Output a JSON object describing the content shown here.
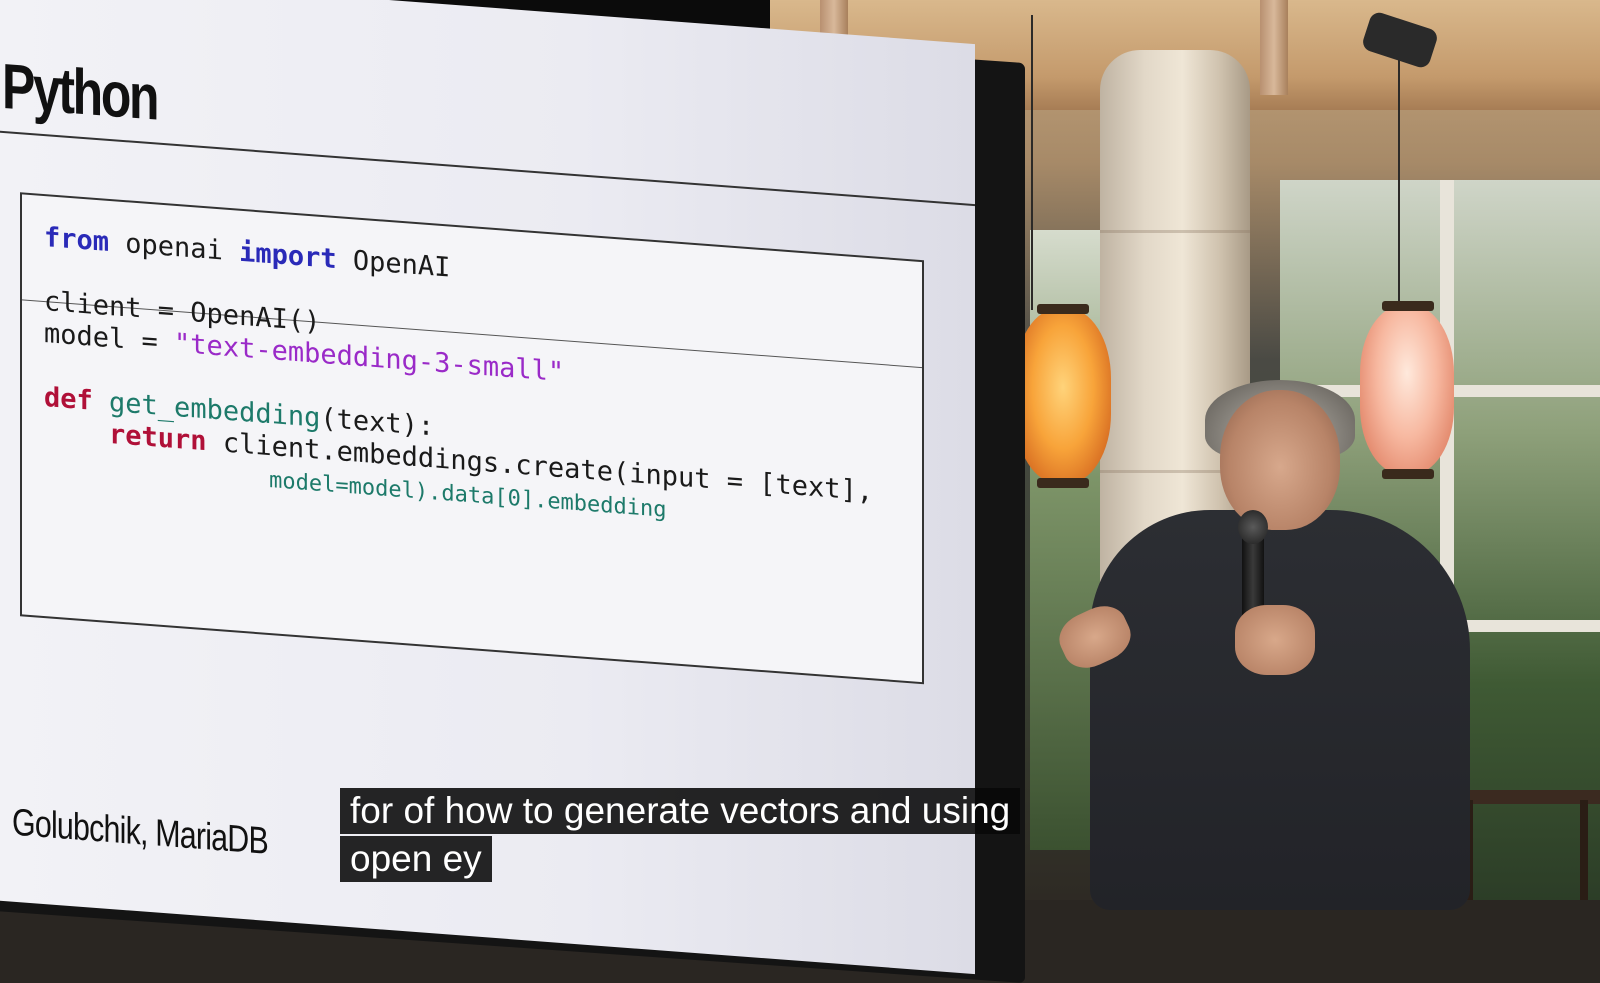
{
  "slide": {
    "title": "Python",
    "footer": "Golubchik, MariaDB",
    "code": {
      "l1_from": "from",
      "l1_mod": " openai ",
      "l1_import": "import",
      "l1_name": " OpenAI",
      "l2": "client = OpenAI()",
      "l3_pre": "model = ",
      "l3_str": "\"text-embedding-3-small\"",
      "l4_def": "def",
      "l4_fn": " get_embedding",
      "l4_rest": "(text):",
      "l5_return": "    return",
      "l5_rest": " client.embeddings.create(input = [text],",
      "l6": "                 model=model).data[0].embedding"
    }
  },
  "captions": {
    "line1": "for of how to generate vectors and using",
    "line2": "open ey"
  },
  "colors": {
    "keyword_blue": "#2a2ab8",
    "keyword_red": "#b01038",
    "string_purple": "#9a2ac8",
    "function_teal": "#1d7a6a",
    "caption_bg": "#080808"
  }
}
